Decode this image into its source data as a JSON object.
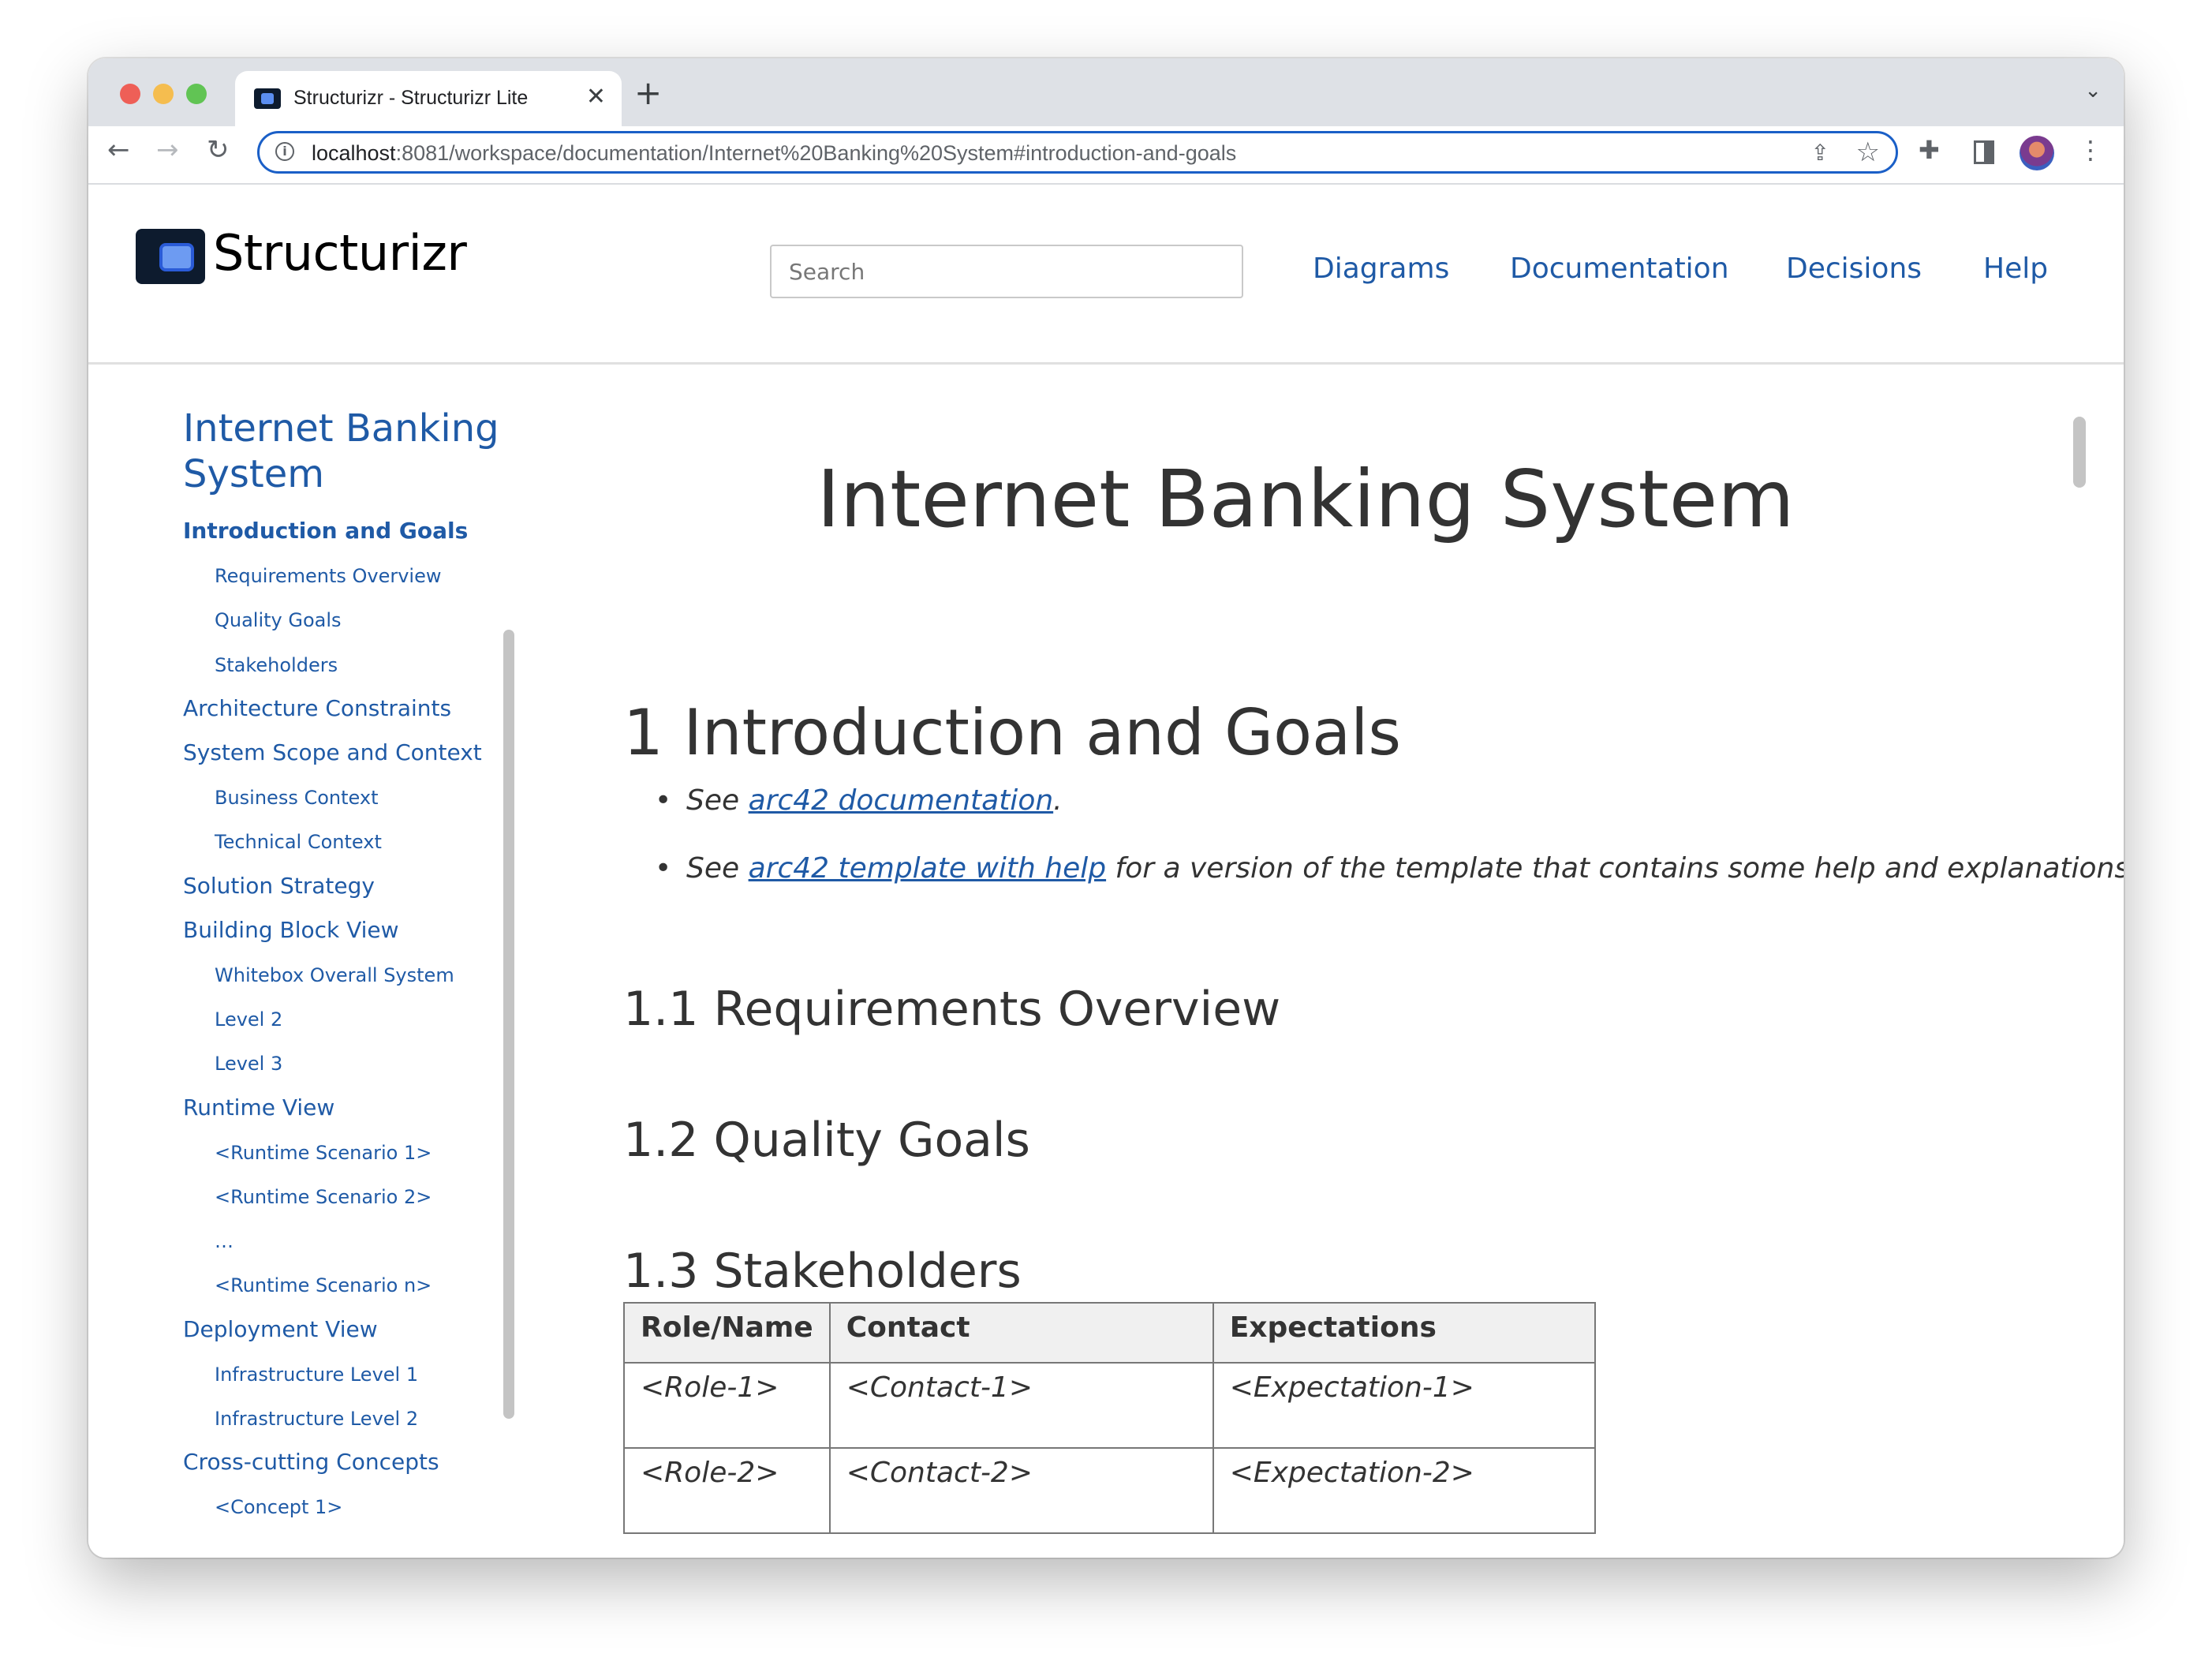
{
  "browser": {
    "tab_title": "Structurizr - Structurizr Lite",
    "url_host": "localhost",
    "url_rest": ":8081/workspace/documentation/Internet%20Banking%20System#introduction-and-goals",
    "close_glyph": "✕",
    "new_tab_glyph": "+",
    "tab_menu_glyph": "⌄",
    "back_glyph": "←",
    "forward_glyph": "→",
    "reload_glyph": "↻",
    "info_glyph": "i",
    "share_glyph": "⇪",
    "star_glyph": "☆",
    "extensions_glyph": "✚",
    "menu_glyph": "⋮"
  },
  "header": {
    "logo_text": "Structurizr",
    "search_placeholder": "Search",
    "nav": {
      "diagrams": "Diagrams",
      "documentation": "Documentation",
      "decisions": "Decisions",
      "help": "Help"
    }
  },
  "sidebar": {
    "title": "Internet Banking System",
    "items": [
      {
        "label": "Introduction and Goals",
        "level": 1,
        "active": true
      },
      {
        "label": "Requirements Overview",
        "level": 2
      },
      {
        "label": "Quality Goals",
        "level": 2
      },
      {
        "label": "Stakeholders",
        "level": 2
      },
      {
        "label": "Architecture Constraints",
        "level": 1
      },
      {
        "label": "System Scope and Context",
        "level": 1
      },
      {
        "label": "Business Context",
        "level": 2
      },
      {
        "label": "Technical Context",
        "level": 2
      },
      {
        "label": "Solution Strategy",
        "level": 1
      },
      {
        "label": "Building Block View",
        "level": 1
      },
      {
        "label": "Whitebox Overall System",
        "level": 2
      },
      {
        "label": "Level 2",
        "level": 2
      },
      {
        "label": "Level 3",
        "level": 2
      },
      {
        "label": "Runtime View",
        "level": 1
      },
      {
        "label": "<Runtime Scenario 1>",
        "level": 2
      },
      {
        "label": "<Runtime Scenario 2>",
        "level": 2
      },
      {
        "label": "…",
        "level": 2
      },
      {
        "label": "<Runtime Scenario n>",
        "level": 2
      },
      {
        "label": "Deployment View",
        "level": 1
      },
      {
        "label": "Infrastructure Level 1",
        "level": 2
      },
      {
        "label": "Infrastructure Level 2",
        "level": 2
      },
      {
        "label": "Cross-cutting Concepts",
        "level": 1
      },
      {
        "label": "<Concept 1>",
        "level": 2
      }
    ]
  },
  "content": {
    "title": "Internet Banking System",
    "section_heading": "1 Introduction and Goals",
    "bullet1": {
      "prefix": "See ",
      "link": "arc42 documentation",
      "suffix": "."
    },
    "bullet2": {
      "prefix": "See ",
      "link": "arc42 template with help",
      "suffix": " for a version of the template that contains some help and explanations."
    },
    "sub1": "1.1 Requirements Overview",
    "sub2": "1.2 Quality Goals",
    "sub3": "1.3 Stakeholders",
    "table": {
      "headers": [
        "Role/Name",
        "Contact",
        "Expectations"
      ],
      "rows": [
        [
          "<Role-1>",
          "<Contact-1>",
          "<Expectation-1>"
        ],
        [
          "<Role-2>",
          "<Contact-2>",
          "<Expectation-2>"
        ]
      ]
    }
  },
  "colors": {
    "link": "#1f5aa6",
    "text": "#333333",
    "omnibox_focus": "#1a5fc7"
  }
}
